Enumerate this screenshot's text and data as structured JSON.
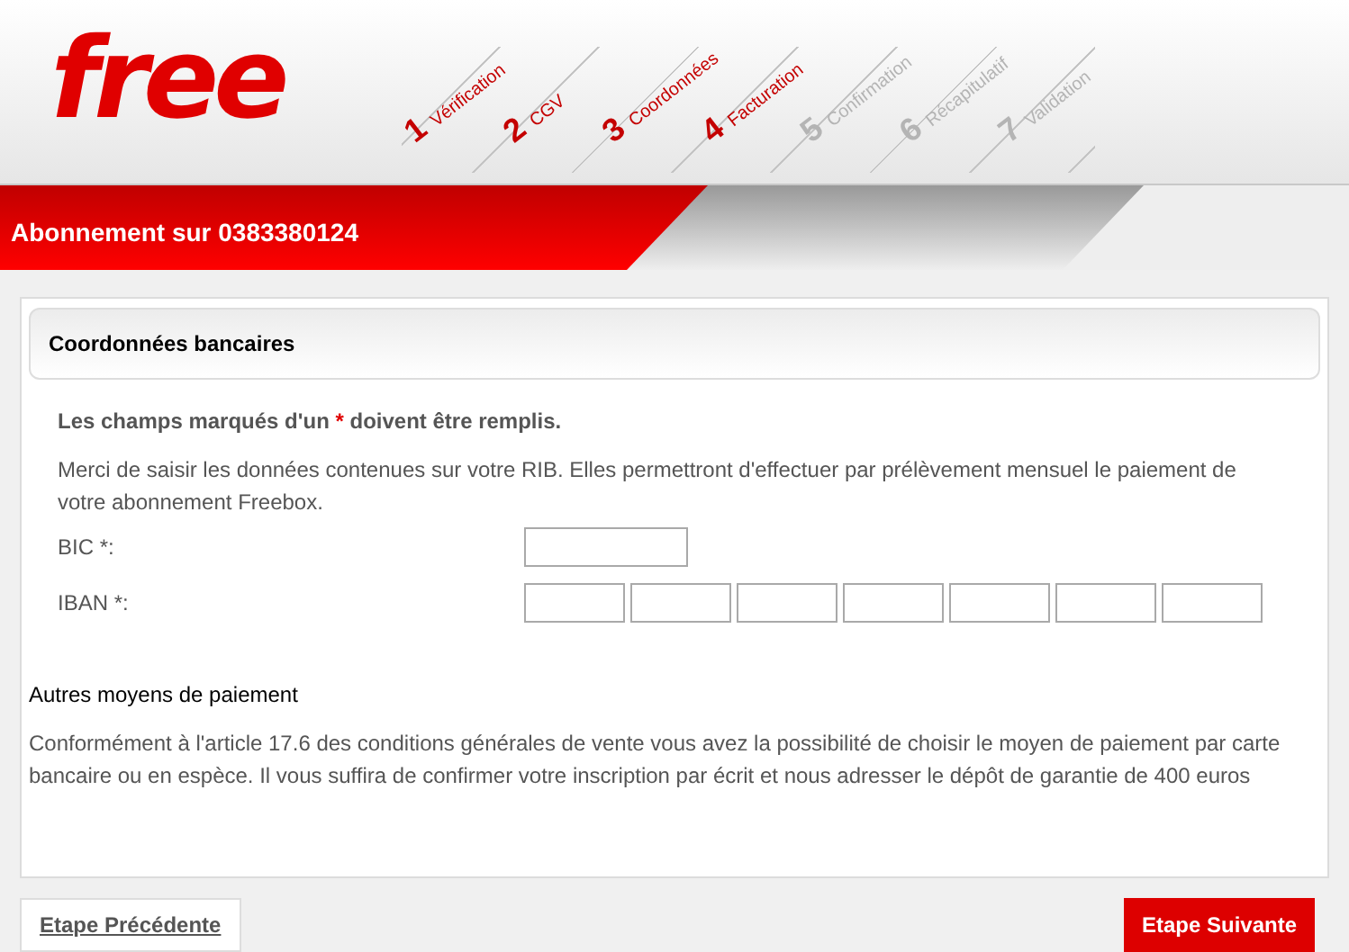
{
  "logo": "free",
  "steps": [
    {
      "number": "1",
      "label": "Vérification",
      "done": true
    },
    {
      "number": "2",
      "label": "CGV",
      "done": true
    },
    {
      "number": "3",
      "label": "Coordonnées",
      "done": true
    },
    {
      "number": "4",
      "label": "Facturation",
      "done": true
    },
    {
      "number": "5",
      "label": "Confirmation",
      "done": false
    },
    {
      "number": "6",
      "label": "Récapitulatif",
      "done": false
    },
    {
      "number": "7",
      "label": "Validation",
      "done": false
    }
  ],
  "banner": "Abonnement sur 0383380124",
  "section_title": "Coordonnées bancaires",
  "required_note": {
    "before": "Les champs marqués d'un ",
    "mark": "*",
    "after": " doivent être remplis."
  },
  "intro": "Merci de saisir les données contenues sur votre RIB. Elles permettront d'effectuer par prélèvement mensuel le paiement de votre abonnement Freebox.",
  "fields": [
    {
      "label": "BIC *:",
      "kind": "bic"
    },
    {
      "label": "IBAN *:",
      "kind": "iban"
    }
  ],
  "other_title": "Autres moyens de paiement",
  "other_text": "Conformément à l'article 17.6 des conditions générales de vente vous avez la possibilité de choisir le moyen de paiement par carte bancaire ou en espèce. Il vous suffira de confirmer votre inscription par écrit et nous adresser le dépôt de garantie de 400 euros",
  "prev_button": "Etape Précédente",
  "next_button": "Etape Suivante"
}
